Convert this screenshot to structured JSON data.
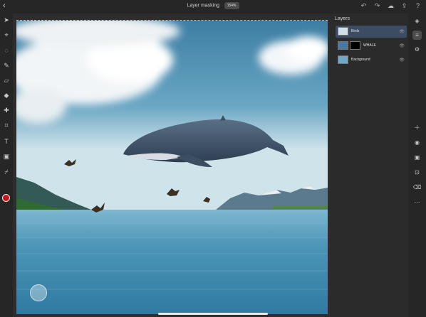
{
  "header": {
    "document_title": "Layer masking",
    "zoom": "154%",
    "icons": [
      "back-icon",
      "undo-icon",
      "redo-icon",
      "cloud-icon",
      "share-icon",
      "help-icon"
    ]
  },
  "left_toolbar": {
    "tools": [
      "select-icon",
      "transform-icon",
      "lasso-icon",
      "brush-icon",
      "eraser-icon",
      "paint-bucket-icon",
      "healing-icon",
      "crop-icon",
      "type-icon",
      "image-place-icon",
      "eyedropper-icon"
    ],
    "foreground_color": "#c0181e",
    "background_color": "#ffffff"
  },
  "layers_panel": {
    "title": "Layers",
    "layers": [
      {
        "name": "Birds",
        "selected": true,
        "has_mask": false
      },
      {
        "name": "WHALE",
        "selected": false,
        "has_mask": true
      },
      {
        "name": "Background",
        "selected": false,
        "has_mask": false
      }
    ]
  },
  "right_toolbar": {
    "tools": [
      "layers-icon",
      "layer-properties-icon",
      "adjustments-icon",
      "add-layer-icon",
      "visibility-icon",
      "mask-icon",
      "fill-icon",
      "clear-icon",
      "more-icon"
    ]
  },
  "colors": {
    "app_bg": "#2a2a2a",
    "selection": "#3b4c63",
    "sky_top": "#3d7ea3",
    "sky_horizon": "#cfe3ea",
    "water": "#3f89ac"
  }
}
